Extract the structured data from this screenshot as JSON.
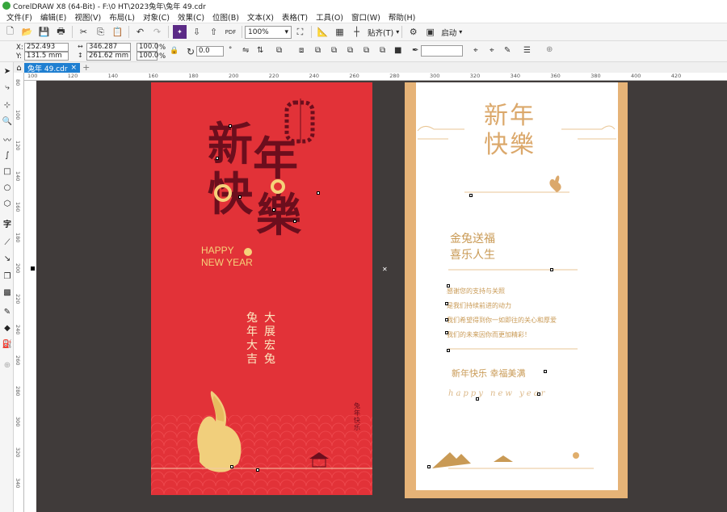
{
  "window": {
    "title": "CorelDRAW X8 (64-Bit) - F:\\0 HT\\2023兔年\\兔年 49.cdr"
  },
  "menu": [
    "文件(F)",
    "编辑(E)",
    "视图(V)",
    "布局(L)",
    "对象(C)",
    "效果(C)",
    "位图(B)",
    "文本(X)",
    "表格(T)",
    "工具(O)",
    "窗口(W)",
    "帮助(H)"
  ],
  "toolbar": {
    "zoom": "100%",
    "snap_label": "贴齐(T)",
    "launch_label": "启动"
  },
  "property_bar": {
    "x": "252.493 mm",
    "y": "131.5 mm",
    "width": "346.287 mm",
    "height": "261.62 mm",
    "scale_x": "100.0",
    "scale_y": "100.0",
    "pct1": "%",
    "pct2": "%",
    "rotation": "0.0",
    "deg": "°",
    "x_label": "X:",
    "y_label": "Y:"
  },
  "doc_tab": {
    "name": "兔年 49.cdr",
    "close": "×",
    "add": "+"
  },
  "ruler": {
    "h_ticks": [
      "100",
      "120",
      "140",
      "160",
      "180",
      "200",
      "220",
      "240",
      "260",
      "280",
      "300",
      "320",
      "340",
      "360",
      "380",
      "400",
      "420"
    ],
    "v_ticks": [
      "80",
      "100",
      "120",
      "140",
      "160",
      "180",
      "200",
      "220",
      "240",
      "260",
      "280",
      "300",
      "320",
      "340"
    ]
  },
  "card1": {
    "title_chars": [
      "新",
      "年",
      "快",
      "樂"
    ],
    "happy": "HAPPY",
    "new_year": "NEW YEAR",
    "col1": "兔年大吉",
    "col2": "大展宏兔",
    "seal": "兔年快乐",
    "colors": {
      "bg": "#e23238",
      "dark": "#6c0e1d",
      "gold": "#f5d27a"
    }
  },
  "card2": {
    "title_line1": "新年",
    "title_line2": "快樂",
    "blessing1": "金兔送福",
    "blessing2": "喜乐人生",
    "lines": [
      "感谢您的支持与关照",
      "是我们持续前进的动力",
      "我们希望得到你一如即往的关心和厚爱",
      "我们的未来因你而更加精彩！"
    ],
    "footer_cn": "新年快乐  幸福美满",
    "footer_en": "happy new year",
    "colors": {
      "border": "#e6b377",
      "accent": "#dba86b"
    }
  }
}
